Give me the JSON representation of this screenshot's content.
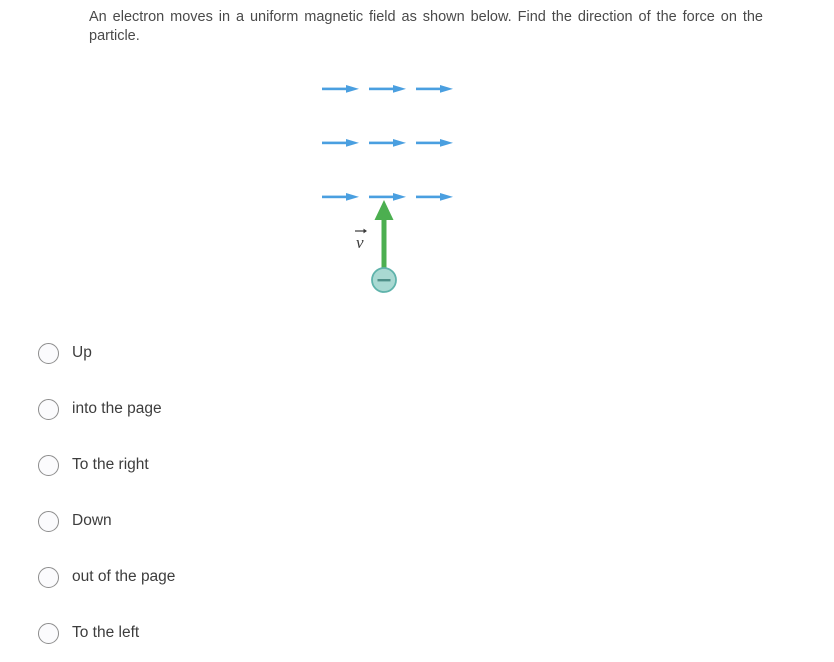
{
  "question": {
    "text": "An electron moves in a uniform magnetic field as shown below. Find the direction of the force on the particle."
  },
  "figure": {
    "name": "magnetic-field-electron-diagram",
    "field_arrow_color": "#4a9fe0",
    "velocity_arrow_color": "#4caf50",
    "particle_fill_color": "#a9d9d2",
    "particle_border_color": "#5fb3ab",
    "particle_sign": "−",
    "velocity_label": "v",
    "field_rows": 3,
    "arrows_per_row": 3,
    "field_direction": "right",
    "velocity_direction": "up",
    "particle_charge": "negative"
  },
  "options": [
    {
      "label": "Up",
      "selected": false
    },
    {
      "label": "into the page",
      "selected": false
    },
    {
      "label": "To the right",
      "selected": false
    },
    {
      "label": "Down",
      "selected": false
    },
    {
      "label": "out of the page",
      "selected": false
    },
    {
      "label": "To the left",
      "selected": false
    }
  ]
}
